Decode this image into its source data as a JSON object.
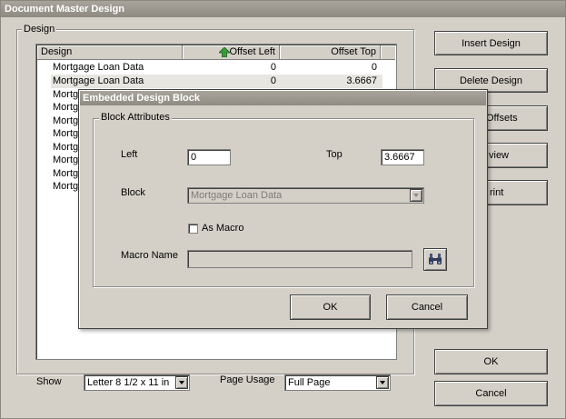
{
  "window": {
    "title": "Document Master Design"
  },
  "design_group": {
    "label": "Design"
  },
  "designs_list": {
    "columns": [
      "Design",
      "Offset Left",
      "Offset Top"
    ],
    "rows": [
      {
        "name": "Mortgage Loan Data",
        "offset_left": "0",
        "offset_top": "0"
      },
      {
        "name": "Mortgage Loan Data",
        "offset_left": "0",
        "offset_top": "3.6667"
      },
      {
        "name": "Mortg",
        "offset_left": "",
        "offset_top": ""
      },
      {
        "name": "Mortg",
        "offset_left": "",
        "offset_top": ""
      },
      {
        "name": "Mortg",
        "offset_left": "",
        "offset_top": ""
      },
      {
        "name": "Mortg",
        "offset_left": "",
        "offset_top": ""
      },
      {
        "name": "Mortg",
        "offset_left": "",
        "offset_top": ""
      },
      {
        "name": "Mortg",
        "offset_left": "",
        "offset_top": ""
      },
      {
        "name": "Mortg",
        "offset_left": "",
        "offset_top": ""
      },
      {
        "name": "Mortg",
        "offset_left": "",
        "offset_top": ""
      }
    ]
  },
  "buttons": {
    "insert_design": "Insert Design",
    "delete_design": "Delete Design",
    "offsets": "Offsets",
    "preview": "view",
    "print": "rint",
    "ok": "OK",
    "cancel": "Cancel"
  },
  "footer": {
    "show_label": "Show",
    "show_value": "Letter 8 1/2 x 11 in",
    "page_usage_label": "Page Usage",
    "page_usage_value": "Full Page"
  },
  "dialog": {
    "title": "Embedded Design Block",
    "group_label": "Block Attributes",
    "left_label": "Left",
    "left_value": "0",
    "top_label": "Top",
    "top_value": "3.6667",
    "block_label": "Block",
    "block_value": "Mortgage Loan Data",
    "as_macro_label": "As Macro",
    "macro_name_label": "Macro Name",
    "macro_name_value": "",
    "ok": "OK",
    "cancel": "Cancel"
  },
  "icons": {
    "sort": "sort-ascending-icon",
    "browse": "binoculars-icon"
  },
  "colors": {
    "sort_arrow": "#3a9a3a"
  }
}
